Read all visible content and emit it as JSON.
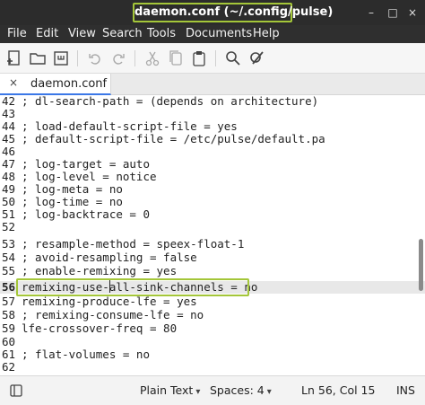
{
  "window": {
    "title": "daemon.conf (~/.config/pulse)",
    "minimize": "–",
    "maximize": "□",
    "close": "×"
  },
  "menu": [
    "File",
    "Edit",
    "View",
    "Search",
    "Tools",
    "Documents",
    "Help"
  ],
  "toolbar": {
    "icons": [
      "new-document-icon",
      "open-folder-icon",
      "save-icon",
      "undo-icon",
      "redo-icon",
      "cut-icon",
      "copy-icon",
      "paste-icon",
      "search-icon",
      "replace-icon"
    ]
  },
  "tab": {
    "close": "×",
    "label": "daemon.conf"
  },
  "editor": {
    "current_line": 56,
    "lines": [
      {
        "num": "42",
        "text": "; dl-search-path = (depends on architecture)"
      },
      {
        "num": "43",
        "text": ""
      },
      {
        "num": "44",
        "text": "; load-default-script-file = yes"
      },
      {
        "num": "45",
        "text": "; default-script-file = /etc/pulse/default.pa"
      },
      {
        "num": "46",
        "text": ""
      },
      {
        "num": "47",
        "text": "; log-target = auto"
      },
      {
        "num": "48",
        "text": "; log-level = notice"
      },
      {
        "num": "49",
        "text": "; log-meta = no"
      },
      {
        "num": "50",
        "text": "; log-time = no"
      },
      {
        "num": "51",
        "text": "; log-backtrace = 0"
      },
      {
        "num": "52",
        "text": ""
      },
      {
        "num": "53",
        "text": "; resample-method = speex-float-1"
      },
      {
        "num": "54",
        "text": "; avoid-resampling = false"
      },
      {
        "num": "55",
        "text": "; enable-remixing = yes"
      },
      {
        "num": "56",
        "text": "remixing-use-all-sink-channels = no"
      },
      {
        "num": "57",
        "text": "remixing-produce-lfe = yes"
      },
      {
        "num": "58",
        "text": "; remixing-consume-lfe = no"
      },
      {
        "num": "59",
        "text": "lfe-crossover-freq = 80"
      },
      {
        "num": "60",
        "text": ""
      },
      {
        "num": "61",
        "text": "; flat-volumes = no"
      },
      {
        "num": "62",
        "text": ""
      }
    ]
  },
  "status": {
    "panel_icon": "side-panel-icon",
    "language": "Plain Text",
    "spaces": "Spaces: 4",
    "position": "Ln 56, Col 15",
    "mode": "INS",
    "chevron": "▾"
  },
  "colors": {
    "highlight_outline": "#a4c639",
    "titlebar": "#2c2c2c",
    "menubar": "#2f2f2f",
    "current_line": "#e8e8e8"
  }
}
